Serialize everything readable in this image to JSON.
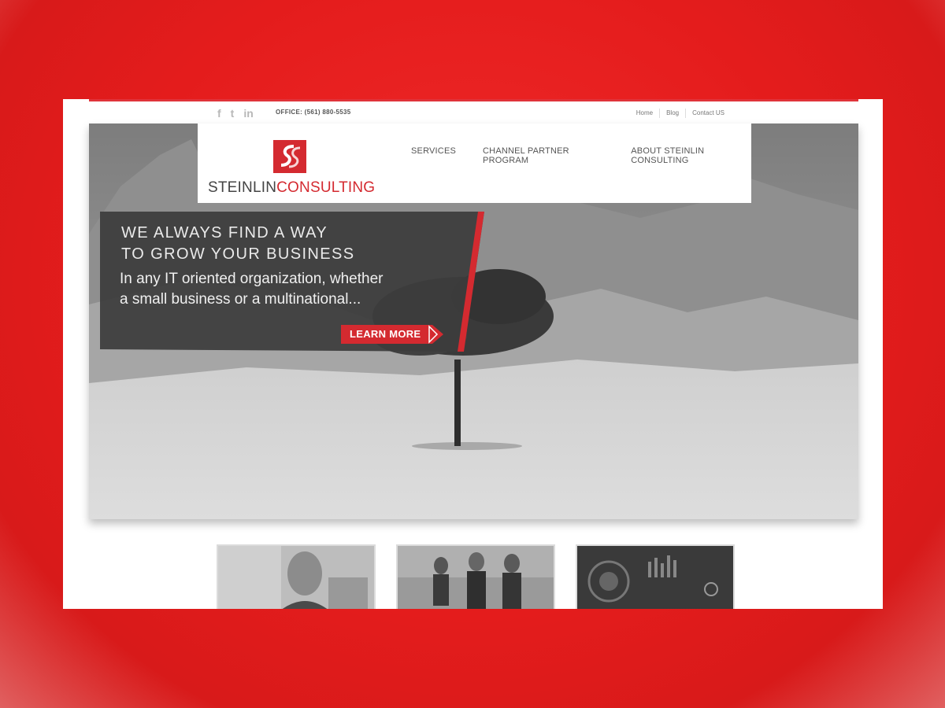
{
  "topbar": {
    "social_icons": [
      {
        "icon": "facebook-icon",
        "glyph": "f"
      },
      {
        "icon": "twitter-icon",
        "glyph": "t"
      },
      {
        "icon": "linkedin-icon",
        "glyph": "in"
      }
    ],
    "office_label": "OFFICE: (561) 880-5535",
    "links": [
      "Home",
      "Blog",
      "Contact US"
    ]
  },
  "brand": {
    "name_part1": "STEINLIN",
    "name_part2": "CONSULTING",
    "mark": "SS"
  },
  "nav": {
    "items": [
      "SERVICES",
      "CHANNEL PARTNER PROGRAM",
      "ABOUT STEINLIN CONSULTING"
    ]
  },
  "hero": {
    "headline_line1": "WE ALWAYS FIND A WAY",
    "headline_line2": "TO GROW YOUR BUSINESS",
    "subline_line1": "In any IT oriented organization, whether",
    "subline_line2": "a small business or a multinational...",
    "cta_label": "LEARN MORE"
  },
  "thumbnails": [
    {
      "name": "thumb-businessman"
    },
    {
      "name": "thumb-triathletes"
    },
    {
      "name": "thumb-technology"
    }
  ],
  "colors": {
    "accent": "#d42a30",
    "page_background": "#e41c1c",
    "banner": "#3c3c3c"
  }
}
